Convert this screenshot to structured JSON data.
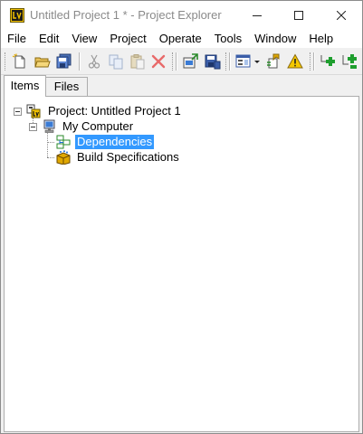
{
  "window": {
    "title": "Untitled Project 1 * - Project Explorer",
    "controls": {
      "minimize": "minimize-icon",
      "maximize": "maximize-icon",
      "close": "close-icon"
    }
  },
  "menubar": {
    "items": [
      {
        "label": "File"
      },
      {
        "label": "Edit"
      },
      {
        "label": "View"
      },
      {
        "label": "Project"
      },
      {
        "label": "Operate"
      },
      {
        "label": "Tools"
      },
      {
        "label": "Window"
      },
      {
        "label": "Help"
      }
    ]
  },
  "toolbar": {
    "buttons": [
      {
        "icon": "new-icon"
      },
      {
        "icon": "open-folder-icon"
      },
      {
        "icon": "save-all-icon"
      },
      {
        "icon": "cut-icon"
      },
      {
        "icon": "copy-icon"
      },
      {
        "icon": "paste-icon"
      },
      {
        "icon": "delete-icon"
      },
      {
        "icon": "deploy-icon"
      },
      {
        "icon": "save-project-icon"
      },
      {
        "icon": "view-options-icon"
      },
      {
        "icon": "dropdown-arrow-icon"
      },
      {
        "icon": "properties-icon"
      },
      {
        "icon": "warning-icon"
      },
      {
        "icon": "expand-all-icon"
      },
      {
        "icon": "collapse-all-icon"
      }
    ]
  },
  "tabs": [
    {
      "label": "Items",
      "active": true
    },
    {
      "label": "Files",
      "active": false
    }
  ],
  "tree": {
    "project": {
      "label": "Project: Untitled Project 1",
      "icon": "project-icon"
    },
    "computer": {
      "label": "My Computer",
      "icon": "computer-icon"
    },
    "children": [
      {
        "label": "Dependencies",
        "icon": "dependencies-icon",
        "selected": true
      },
      {
        "label": "Build Specifications",
        "icon": "build-specifications-icon",
        "selected": false
      }
    ]
  },
  "colors": {
    "selection": "#3399ff",
    "title_text": "#8a8a8a"
  }
}
